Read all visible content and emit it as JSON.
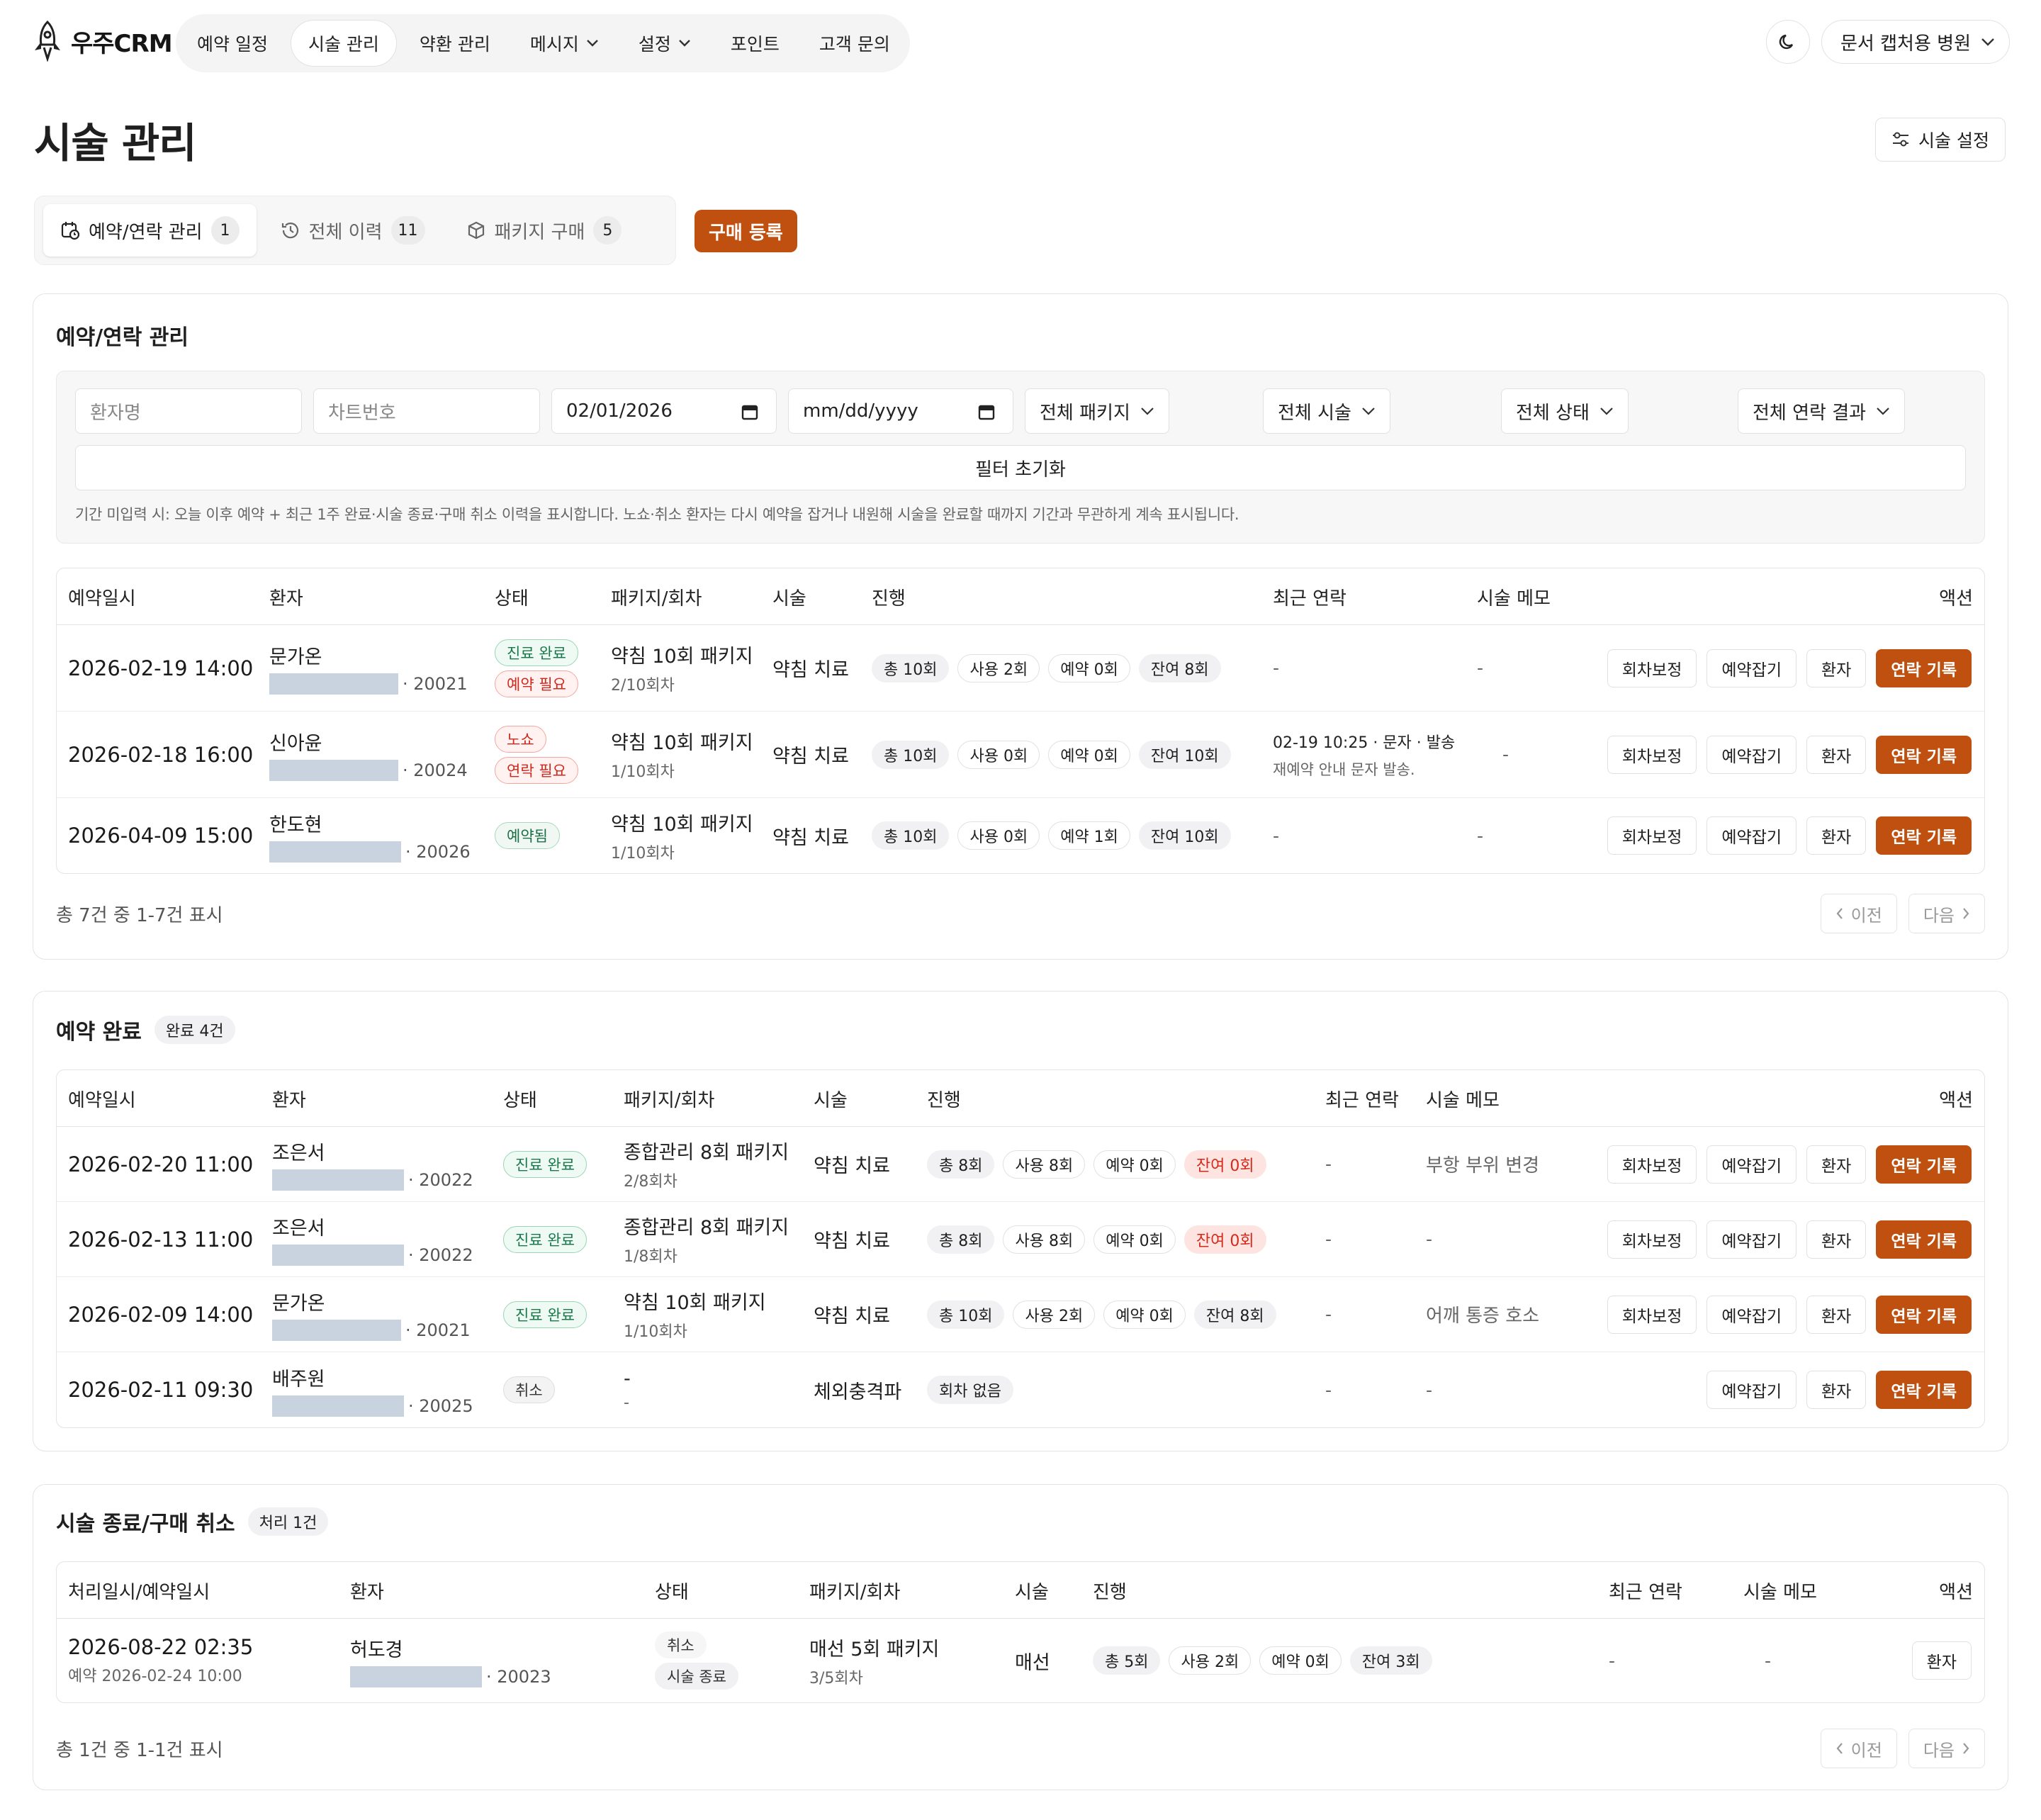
{
  "app": {
    "name": "우주CRM"
  },
  "nav": {
    "items": [
      {
        "label": "예약 일정"
      },
      {
        "label": "시술 관리",
        "active": true
      },
      {
        "label": "약환 관리"
      },
      {
        "label": "메시지",
        "dropdown": true
      },
      {
        "label": "설정",
        "dropdown": true
      },
      {
        "label": "포인트"
      },
      {
        "label": "고객 문의"
      }
    ],
    "hospital": "문서 캡처용 병원"
  },
  "page": {
    "title": "시술 관리",
    "settings_label": "시술 설정"
  },
  "tabs": [
    {
      "label": "예약/연락 관리",
      "count": "1",
      "active": true
    },
    {
      "label": "전체 이력",
      "count": "11"
    },
    {
      "label": "패키지 구매",
      "count": "5"
    }
  ],
  "buy_button": "구매 등록",
  "section1": {
    "title": "예약/연락 관리",
    "filters": {
      "patient_placeholder": "환자명",
      "chart_placeholder": "차트번호",
      "date_from": "02/01/2026",
      "date_to": "mm/dd/yyyy",
      "package": "전체 패키지",
      "procedure": "전체 시술",
      "status": "전체 상태",
      "contact_result": "전체 연락 결과",
      "reset": "필터 초기화",
      "hint": "기간 미입력 시: 오늘 이후 예약 + 최근 1주 완료·시술 종료·구매 취소 이력을 표시합니다. 노쇼·취소 환자는 다시 예약을 잡거나 내원해 시술을 완료할 때까지 기간과 무관하게 계속 표시됩니다."
    },
    "headers": [
      "예약일시",
      "환자",
      "상태",
      "패키지/회차",
      "시술",
      "진행",
      "최근 연락",
      "시술 메모",
      "액션"
    ],
    "rows": [
      {
        "date": "2026-02-19 14:00",
        "name": "문가온",
        "id": "· 20021",
        "badges": [
          {
            "t": "진료 완료",
            "c": "green"
          },
          {
            "t": "예약 필요",
            "c": "red"
          }
        ],
        "pkg": "약침 10회 패키지",
        "round": "2/10회차",
        "proc": "약침 치료",
        "chips": [
          "총 10회",
          "사용 2회",
          "예약 0회",
          "잔여 8회"
        ],
        "contact": "-",
        "contact_sub": "",
        "memo": "-"
      },
      {
        "date": "2026-02-18 16:00",
        "name": "신아윤",
        "id": "· 20024",
        "badges": [
          {
            "t": "노쇼",
            "c": "red"
          },
          {
            "t": "연락 필요",
            "c": "red"
          }
        ],
        "pkg": "약침 10회 패키지",
        "round": "1/10회차",
        "proc": "약침 치료",
        "chips": [
          "총 10회",
          "사용 0회",
          "예약 0회",
          "잔여 10회"
        ],
        "contact": "02-19 10:25 · 문자 · 발송",
        "contact_sub": "재예약 안내 문자 발송.",
        "memo": "-"
      },
      {
        "date": "2026-04-09 15:00",
        "name": "한도현",
        "id": "· 20026",
        "badges": [
          {
            "t": "예약됨",
            "c": "gray"
          }
        ],
        "pkg": "약침 10회 패키지",
        "round": "1/10회차",
        "proc": "약침 치료",
        "chips": [
          "총 10회",
          "사용 0회",
          "예약 1회",
          "잔여 10회"
        ],
        "contact": "-",
        "contact_sub": "",
        "memo": "-"
      }
    ],
    "actions": [
      "회차보정",
      "예약잡기",
      "환자",
      "연락 기록"
    ],
    "pager_text": "총 7건 중 1-7건 표시",
    "prev": "이전",
    "next": "다음"
  },
  "section2": {
    "title": "예약 완료",
    "count": "완료 4건",
    "headers": [
      "예약일시",
      "환자",
      "상태",
      "패키지/회차",
      "시술",
      "진행",
      "최근 연락",
      "시술 메모",
      "액션"
    ],
    "rows": [
      {
        "date": "2026-02-20 11:00",
        "name": "조은서",
        "id": "· 20022",
        "badge": "진료 완료",
        "badge_c": "green",
        "pkg": "종합관리 8회 패키지",
        "round": "2/8회차",
        "proc": "약침 치료",
        "chips": [
          "총 8회",
          "사용 8회",
          "예약 0회",
          "잔여 0회"
        ],
        "contact": "-",
        "memo": "부항 부위 변경"
      },
      {
        "date": "2026-02-13 11:00",
        "name": "조은서",
        "id": "· 20022",
        "badge": "진료 완료",
        "badge_c": "green",
        "pkg": "종합관리 8회 패키지",
        "round": "1/8회차",
        "proc": "약침 치료",
        "chips": [
          "총 8회",
          "사용 8회",
          "예약 0회",
          "잔여 0회"
        ],
        "contact": "-",
        "memo": "-"
      },
      {
        "date": "2026-02-09 14:00",
        "name": "문가온",
        "id": "· 20021",
        "badge": "진료 완료",
        "badge_c": "green",
        "pkg": "약침 10회 패키지",
        "round": "1/10회차",
        "proc": "약침 치료",
        "chips": [
          "총 10회",
          "사용 2회",
          "예약 0회",
          "잔여 8회"
        ],
        "contact": "-",
        "memo": "어깨 통증 호소"
      },
      {
        "date": "2026-02-11 09:30",
        "name": "배주원",
        "id": "· 20025",
        "badge": "취소",
        "badge_c": "gray",
        "pkg": "-",
        "round": "-",
        "proc": "체외충격파",
        "chips": [
          "회차 없음"
        ],
        "contact": "-",
        "memo": "-"
      }
    ]
  },
  "section3": {
    "title": "시술 종료/구매 취소",
    "count": "처리 1건",
    "headers": [
      "처리일시/예약일시",
      "환자",
      "상태",
      "패키지/회차",
      "시술",
      "진행",
      "최근 연락",
      "시술 메모",
      "액션"
    ],
    "row": {
      "date": "2026-08-22 02:35",
      "date_sub": "예약 2026-02-24 10:00",
      "name": "허도경",
      "id": "· 20023",
      "badges": [
        "취소",
        "시술 종료"
      ],
      "pkg": "매선 5회 패키지",
      "round": "3/5회차",
      "proc": "매선",
      "chips": [
        "총 5회",
        "사용 2회",
        "예약 0회",
        "잔여 3회"
      ],
      "contact": "-",
      "memo": "-",
      "action": "환자"
    },
    "pager_text": "총 1건 중 1-1건 표시",
    "prev": "이전",
    "next": "다음"
  },
  "colors": {
    "accent": "#c0500f",
    "green": "#19794a",
    "red": "#cc2a1e"
  }
}
